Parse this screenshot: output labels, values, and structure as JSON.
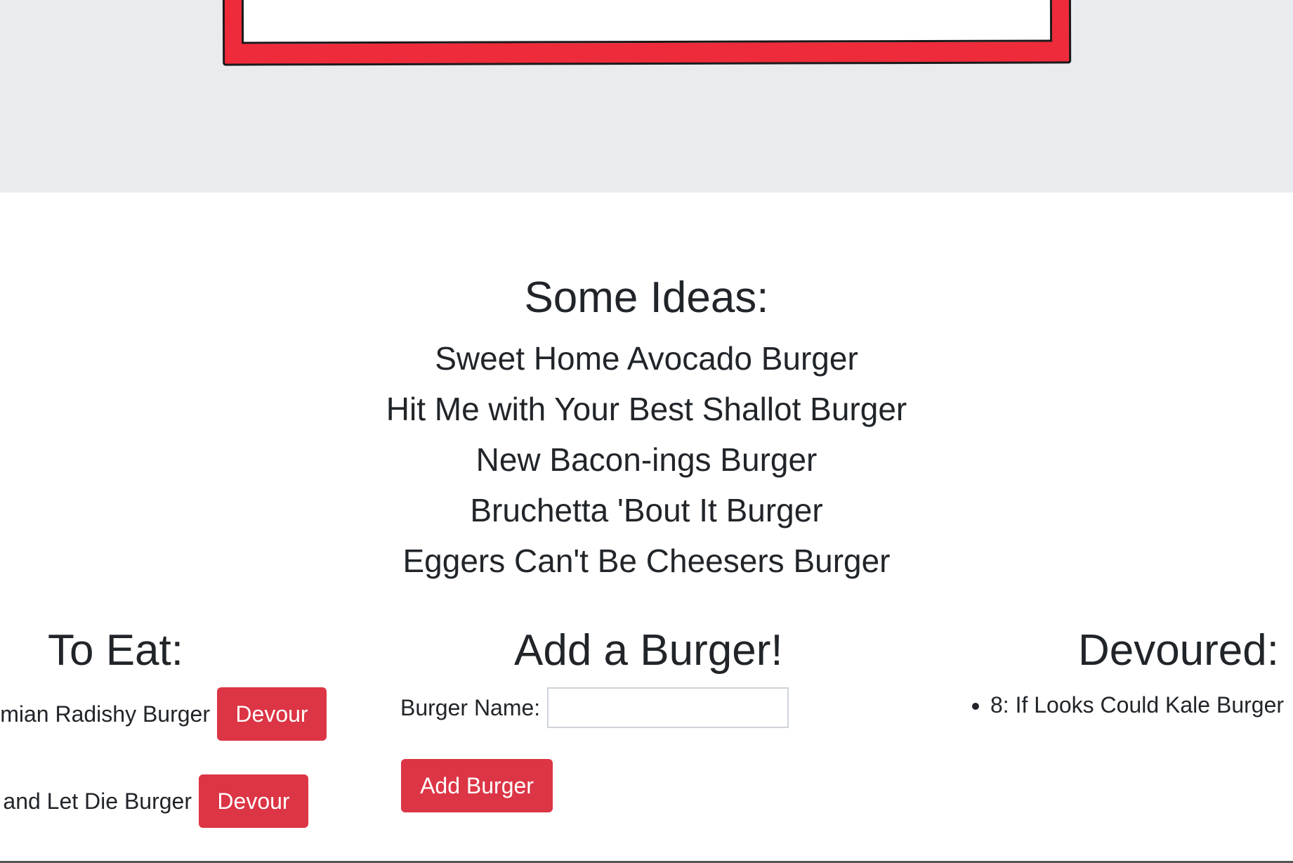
{
  "ideas": {
    "heading": "Some Ideas:",
    "items": [
      "Sweet Home Avocado Burger",
      "Hit Me with Your Best Shallot Burger",
      "New Bacon-ings Burger",
      "Bruchetta 'Bout It Burger",
      "Eggers Can't Be Cheesers Burger"
    ]
  },
  "to_eat": {
    "heading": "To Eat:",
    "items": [
      {
        "name": "emian Radishy Burger",
        "button": "Devour"
      },
      {
        "name": "and Let Die Burger",
        "button": "Devour"
      }
    ]
  },
  "add": {
    "heading": "Add a Burger!",
    "label": "Burger Name:",
    "input_value": "",
    "button": "Add Burger"
  },
  "devoured": {
    "heading": "Devoured:",
    "items": [
      "8: If Looks Could Kale Burger"
    ]
  },
  "colors": {
    "jumbotron_bg": "#e9ecef",
    "button_red": "#dc3545",
    "logo_red": "#ee2b3b"
  }
}
